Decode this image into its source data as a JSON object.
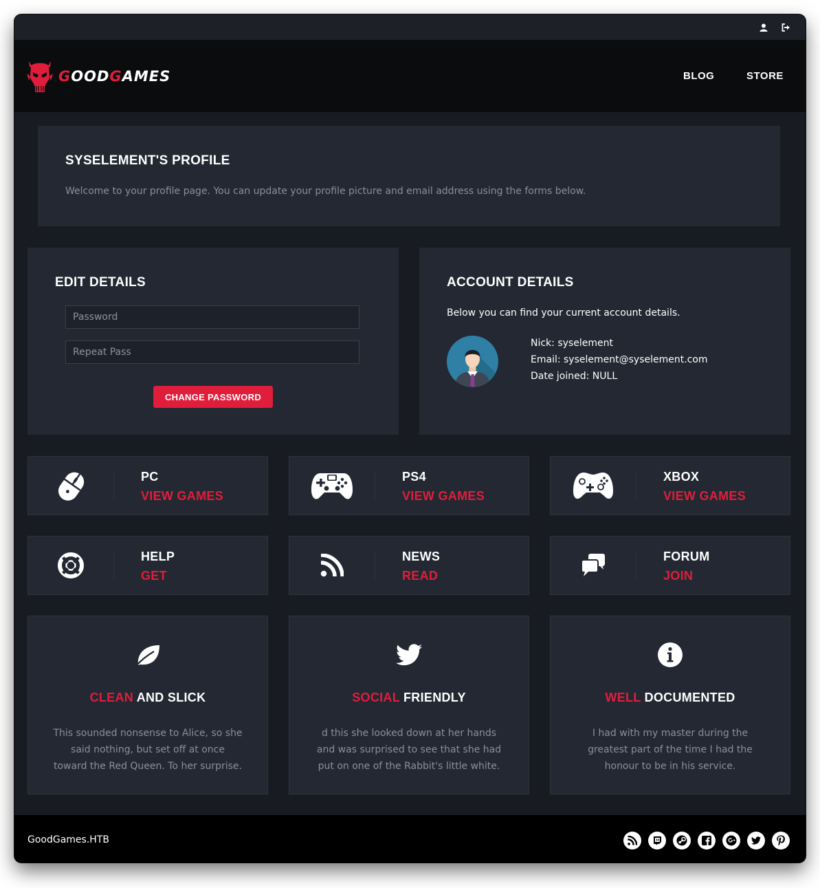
{
  "topbar": {
    "icons": [
      "user-icon",
      "sign-out-icon"
    ]
  },
  "header": {
    "logo": {
      "part1": "G",
      "part2": "OOD",
      "part3": "G",
      "part4": "AMES"
    },
    "nav": [
      "BLOG",
      "STORE"
    ]
  },
  "profile": {
    "title": "SYSELEMENT'S PROFILE",
    "subtitle": "Welcome to your profile page. You can update your profile picture and email address using the forms below."
  },
  "edit": {
    "title": "EDIT DETAILS",
    "password_placeholder": "Password",
    "repeat_placeholder": "Repeat Pass",
    "button": "CHANGE PASSWORD"
  },
  "account": {
    "title": "ACCOUNT DETAILS",
    "intro": "Below you can find your current account details.",
    "nick": "Nick: syselement",
    "email": "Email: syselement@syselement.com",
    "joined": "Date joined: NULL"
  },
  "categories": [
    {
      "title": "PC",
      "action": "VIEW GAMES",
      "icon": "mouse-icon"
    },
    {
      "title": "PS4",
      "action": "VIEW GAMES",
      "icon": "ps4-controller-icon"
    },
    {
      "title": "XBOX",
      "action": "VIEW GAMES",
      "icon": "xbox-controller-icon"
    },
    {
      "title": "HELP",
      "action": "GET",
      "icon": "lifebuoy-icon"
    },
    {
      "title": "NEWS",
      "action": "READ",
      "icon": "rss-icon"
    },
    {
      "title": "FORUM",
      "action": "JOIN",
      "icon": "comments-icon"
    }
  ],
  "features": [
    {
      "accent": "CLEAN",
      "rest": " AND SLICK",
      "desc": "This sounded nonsense to Alice, so she said nothing, but set off at once toward the Red Queen. To her surprise.",
      "icon": "leaf-icon"
    },
    {
      "accent": "SOCIAL",
      "rest": " FRIENDLY",
      "desc": "d this she looked down at her hands and was surprised to see that she had put on one of the Rabbit's little white.",
      "icon": "twitter-icon"
    },
    {
      "accent": "WELL",
      "rest": " DOCUMENTED",
      "desc": "I had with my master during the greatest part of the time I had the honour to be in his service.",
      "icon": "info-icon"
    }
  ],
  "footer": {
    "brand": "GoodGames.HTB",
    "social": [
      "rss-icon",
      "twitch-icon",
      "steam-icon",
      "facebook-icon",
      "google-plus-icon",
      "twitter-icon",
      "pinterest-icon"
    ]
  },
  "colors": {
    "accent": "#e01e3c",
    "panel": "#232832",
    "background": "#181c22",
    "header": "#0b0c0e",
    "footer": "#000000"
  }
}
